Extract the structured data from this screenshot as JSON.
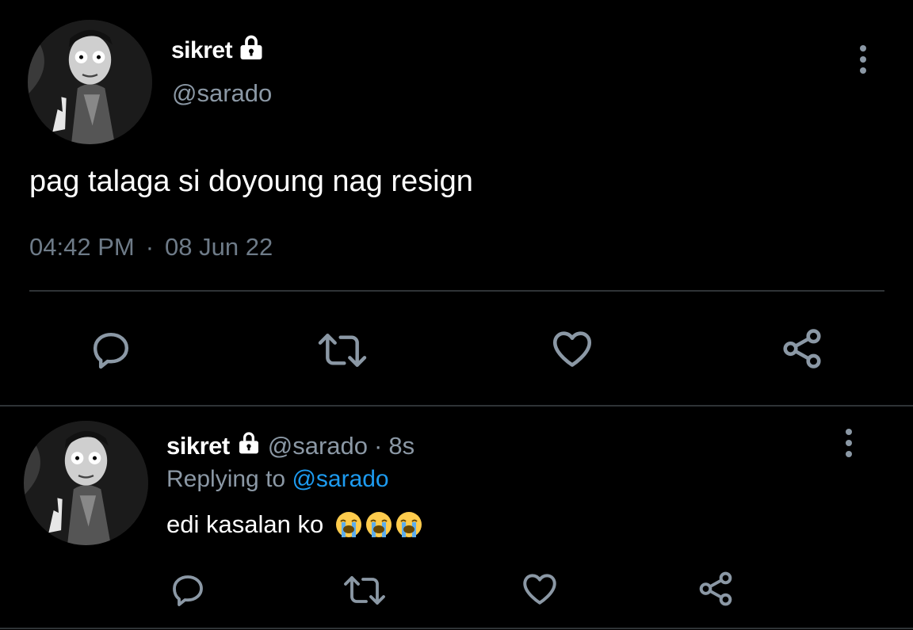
{
  "main_tweet": {
    "display_name": "sikret",
    "handle": "@sarado",
    "text": "pag talaga si doyoung nag resign",
    "time": "04:42 PM",
    "separator": "·",
    "date": "08 Jun 22"
  },
  "reply": {
    "display_name": "sikret",
    "handle": "@sarado",
    "separator": "·",
    "age": "8s",
    "replying_prefix": "Replying to",
    "replying_mention": "@sarado",
    "text": "edi kasalan ko",
    "emojis": [
      "loudly-crying-face",
      "loudly-crying-face",
      "loudly-crying-face"
    ]
  },
  "icons": {
    "lock": "lock-icon",
    "more": "more-vertical-icon",
    "reply": "comment-icon",
    "retweet": "retweet-icon",
    "like": "heart-icon",
    "share": "share-icon"
  },
  "colors": {
    "background": "#000000",
    "primary_text": "#ffffff",
    "secondary_text": "#8b98a5",
    "mention": "#1d9bf0",
    "divider": "#2f3336"
  }
}
